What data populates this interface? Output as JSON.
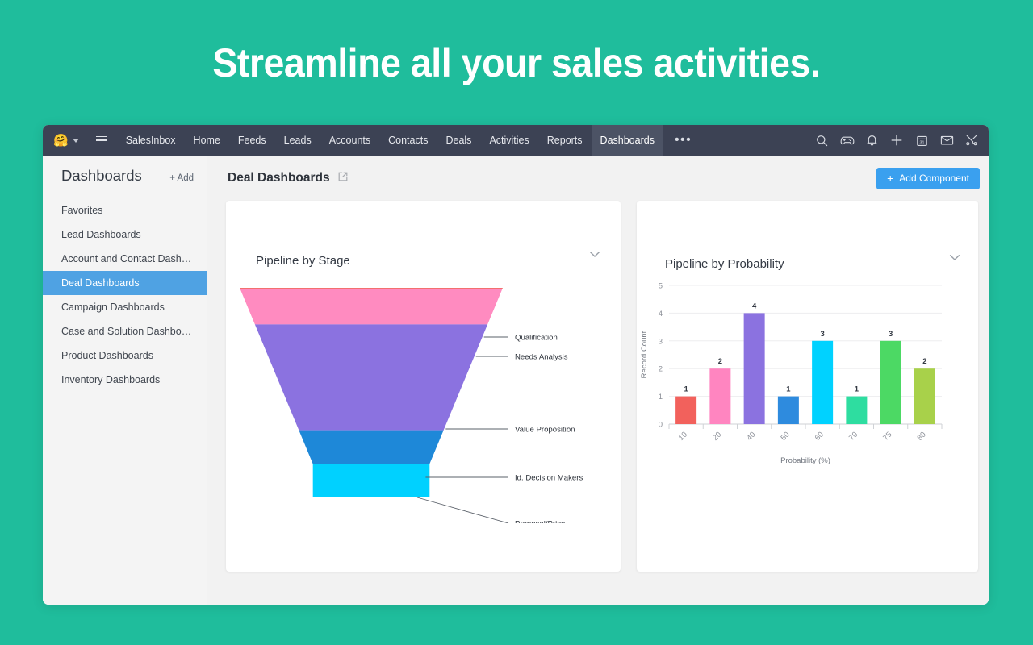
{
  "banner": {
    "headline": "Streamline all your sales activities."
  },
  "topnav": {
    "logo_icon": "crm-logo-icon",
    "menu_icon": "hamburger-menu-icon",
    "items": [
      {
        "label": "SalesInbox",
        "active": false
      },
      {
        "label": "Home",
        "active": false
      },
      {
        "label": "Feeds",
        "active": false
      },
      {
        "label": "Leads",
        "active": false
      },
      {
        "label": "Accounts",
        "active": false
      },
      {
        "label": "Contacts",
        "active": false
      },
      {
        "label": "Deals",
        "active": false
      },
      {
        "label": "Activities",
        "active": false
      },
      {
        "label": "Reports",
        "active": false
      },
      {
        "label": "Dashboards",
        "active": true
      }
    ],
    "overflow_label": "•••",
    "icons": [
      "search-icon",
      "gamepad-icon",
      "bell-icon",
      "plus-icon",
      "calendar-icon",
      "envelope-icon",
      "tools-icon"
    ],
    "calendar_day": "31",
    "background_color": "#3c4254",
    "active_color": "#4c5365"
  },
  "sidebar": {
    "title": "Dashboards",
    "add_label": "+ Add",
    "active_color": "#4fa2e3",
    "items": [
      {
        "label": "Favorites",
        "active": false
      },
      {
        "label": "Lead Dashboards",
        "active": false
      },
      {
        "label": "Account and Contact Dashbo...",
        "active": false
      },
      {
        "label": "Deal Dashboards",
        "active": true
      },
      {
        "label": "Campaign Dashboards",
        "active": false
      },
      {
        "label": "Case and Solution Dashboards",
        "active": false
      },
      {
        "label": "Product Dashboards",
        "active": false
      },
      {
        "label": "Inventory Dashboards",
        "active": false
      }
    ]
  },
  "main": {
    "title": "Deal Dashboards",
    "popout_icon": "open-in-new-icon",
    "add_component_label": "Add Component",
    "add_component_color": "#3aa0ef"
  },
  "chart_data": [
    {
      "type": "funnel",
      "title": "Pipeline by Stage",
      "collapse_icon": "chevron-down-icon",
      "stages": [
        {
          "label": "Qualification",
          "color": "#F3706E",
          "weight": 0.04
        },
        {
          "label": "Needs Analysis",
          "color": "#FF8BC0",
          "weight": 1.05
        },
        {
          "label": "Value Proposition",
          "color": "#8B72E0",
          "weight": 3.15
        },
        {
          "label": "Id. Decision Makers",
          "color": "#1E88D8",
          "weight": 1.0
        },
        {
          "label": "Proposal/Price Quote",
          "color": "#00D1FF",
          "weight": 1.0
        }
      ]
    },
    {
      "type": "bar",
      "title": "Pipeline by Probability",
      "collapse_icon": "chevron-down-icon",
      "categories": [
        "10",
        "20",
        "40",
        "50",
        "60",
        "70",
        "75",
        "80"
      ],
      "values": [
        1,
        2,
        4,
        1,
        3,
        1,
        3,
        2
      ],
      "colors": [
        "#F2615C",
        "#FF85C0",
        "#8B72E0",
        "#2E8BDE",
        "#00D2FF",
        "#2EDDA0",
        "#4CD964",
        "#A8D14A"
      ],
      "xlabel": "Probability (%)",
      "ylabel": "Record Count",
      "yticks": [
        0,
        1,
        2,
        3,
        4,
        5
      ],
      "ylim": [
        0,
        5
      ],
      "grid": true,
      "legend": "none"
    }
  ]
}
